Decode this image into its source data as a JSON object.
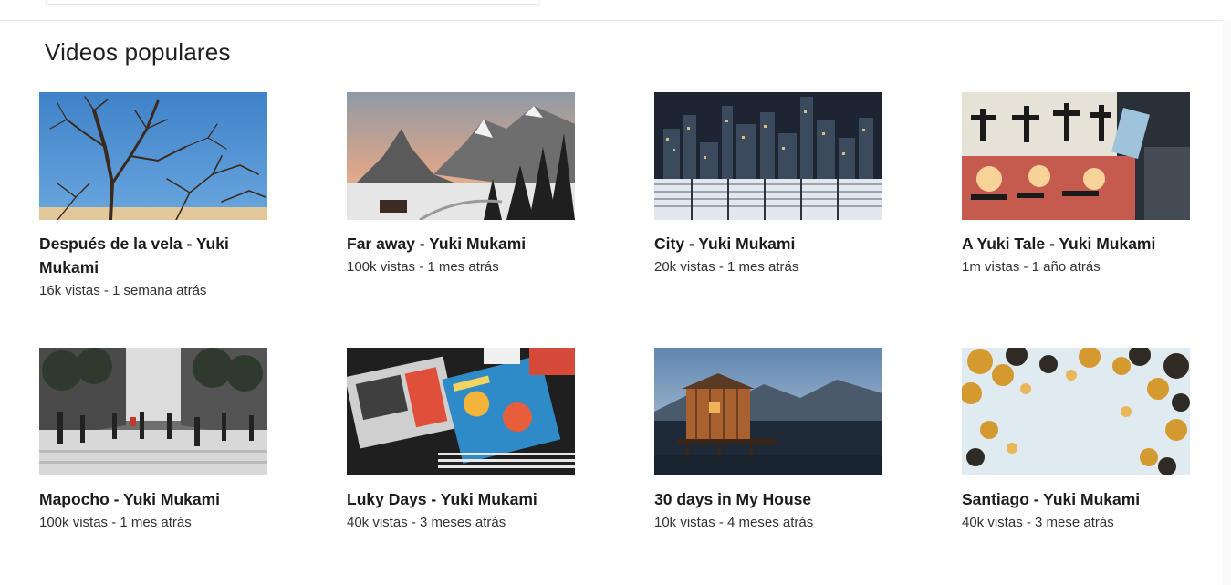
{
  "section": {
    "title": "Videos populares"
  },
  "videos": [
    {
      "title": "Después de la vela - Yuki Mukami",
      "views": "16k vistas",
      "age": "1 semana atrás",
      "meta": "16k vistas - 1 semana atrás",
      "thumb_icon": "tree-sky-thumbnail"
    },
    {
      "title": "Far away - Yuki Mukami",
      "views": "100k vistas",
      "age": "1 mes atrás",
      "meta": "100k vistas - 1 mes atrás",
      "thumb_icon": "snowy-mountains-thumbnail"
    },
    {
      "title": "City - Yuki Mukami",
      "views": "20k vistas",
      "age": "1 mes atrás",
      "meta": "20k vistas - 1 mes atrás",
      "thumb_icon": "city-night-thumbnail"
    },
    {
      "title": "A Yuki Tale - Yuki Mukami",
      "views": "1m vistas",
      "age": "1 año atrás",
      "meta": "1m vistas - 1 año atrás",
      "thumb_icon": "japanese-street-thumbnail"
    },
    {
      "title": "Mapocho - Yuki Mukami",
      "views": "100k vistas",
      "age": "1 mes atrás",
      "meta": "100k vistas - 1 mes atrás",
      "thumb_icon": "street-crowd-thumbnail"
    },
    {
      "title": "Luky Days - Yuki Mukami",
      "views": "40k vistas",
      "age": "3 meses atrás",
      "meta": "40k vistas - 3 meses atrás",
      "thumb_icon": "magazines-thumbnail"
    },
    {
      "title": "30 days in My House",
      "views": "10k vistas",
      "age": "4 meses atrás",
      "meta": "10k vistas - 4 meses atrás",
      "thumb_icon": "lake-house-thumbnail"
    },
    {
      "title": "Santiago - Yuki Mukami",
      "views": "40k vistas",
      "age": "3 mese atrás",
      "meta": "40k vistas - 3 mese atrás",
      "thumb_icon": "autumn-leaves-thumbnail"
    }
  ],
  "colors": {
    "text": "#1c1c1c",
    "meta_text": "#333333",
    "divider": "#e6e6e6"
  }
}
